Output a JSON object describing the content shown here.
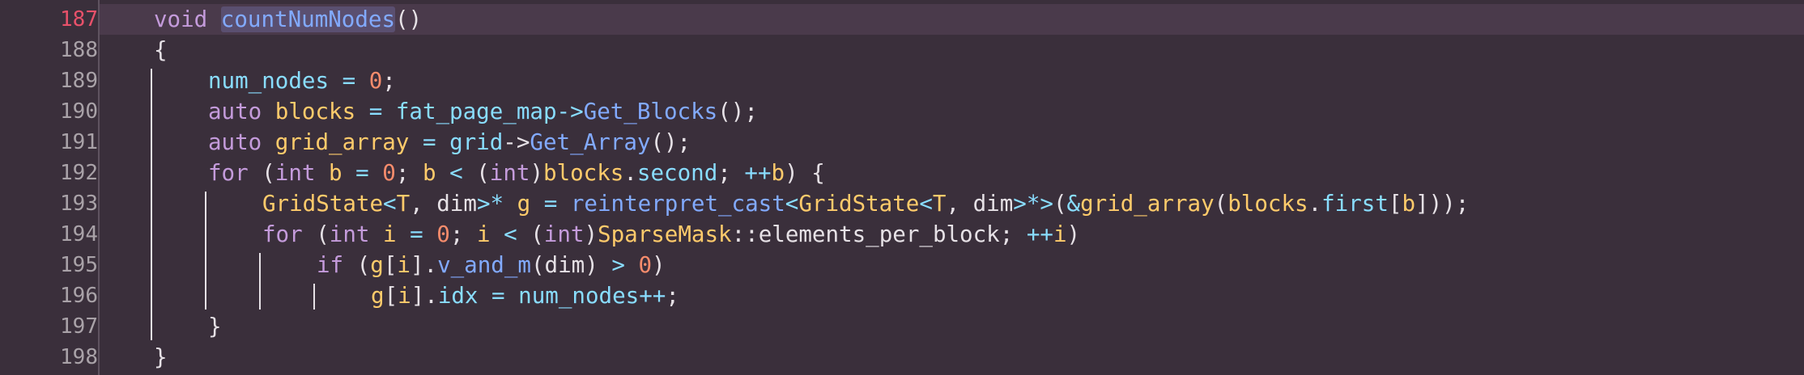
{
  "editor": {
    "language": "cpp",
    "current_line": "187",
    "colors": {
      "background": "#3a2f3b",
      "current_line_bg": "#4a3a4b",
      "active_line_number": "#e8516a",
      "line_number": "#a9a2a8",
      "keyword": "#c49bdb",
      "function": "#82aaff",
      "variable": "#89ddff",
      "type": "#ffcb6b",
      "number": "#f78c6c",
      "text": "#e6e1e6"
    },
    "line_numbers": [
      "187",
      "188",
      "189",
      "190",
      "191",
      "192",
      "193",
      "194",
      "195",
      "196",
      "197",
      "198"
    ],
    "lines": [
      [
        [
          "kw",
          "void"
        ],
        [
          "pl",
          " "
        ],
        [
          "fn hl",
          "countNumNodes"
        ],
        [
          "pl",
          "()"
        ]
      ],
      [
        [
          "pl",
          "{"
        ]
      ],
      [
        [
          "vr",
          "num_nodes"
        ],
        [
          "pl",
          " "
        ],
        [
          "op",
          "="
        ],
        [
          "pl",
          " "
        ],
        [
          "num",
          "0"
        ],
        [
          "pl",
          ";"
        ]
      ],
      [
        [
          "kw",
          "auto"
        ],
        [
          "pl",
          " "
        ],
        [
          "vy",
          "blocks"
        ],
        [
          "pl",
          " "
        ],
        [
          "op",
          "="
        ],
        [
          "pl",
          " "
        ],
        [
          "vr",
          "fat_page_map"
        ],
        [
          "op",
          "->"
        ],
        [
          "fn",
          "Get_Blocks"
        ],
        [
          "pl",
          "();"
        ]
      ],
      [
        [
          "kw",
          "auto"
        ],
        [
          "pl",
          " "
        ],
        [
          "vy",
          "grid_array"
        ],
        [
          "pl",
          " "
        ],
        [
          "op",
          "="
        ],
        [
          "pl",
          " "
        ],
        [
          "vr",
          "grid"
        ],
        [
          "pl",
          "->"
        ],
        [
          "fn",
          "Get_Array"
        ],
        [
          "pl",
          "();"
        ]
      ],
      [
        [
          "kw",
          "for"
        ],
        [
          "pl",
          " ("
        ],
        [
          "kw",
          "int"
        ],
        [
          "pl",
          " "
        ],
        [
          "vy",
          "b"
        ],
        [
          "pl",
          " "
        ],
        [
          "op",
          "="
        ],
        [
          "pl",
          " "
        ],
        [
          "num",
          "0"
        ],
        [
          "pl",
          "; "
        ],
        [
          "vy",
          "b"
        ],
        [
          "pl",
          " "
        ],
        [
          "op",
          "<"
        ],
        [
          "pl",
          " ("
        ],
        [
          "kw",
          "int"
        ],
        [
          "pl",
          ")"
        ],
        [
          "vy",
          "blocks"
        ],
        [
          "pl",
          "."
        ],
        [
          "vr",
          "second"
        ],
        [
          "pl",
          "; "
        ],
        [
          "op",
          "++"
        ],
        [
          "vy",
          "b"
        ],
        [
          "pl",
          ") {"
        ]
      ],
      [
        [
          "vy",
          "GridState"
        ],
        [
          "op",
          "<"
        ],
        [
          "vy",
          "T"
        ],
        [
          "pl",
          ", dim"
        ],
        [
          "op",
          ">*"
        ],
        [
          "pl",
          " "
        ],
        [
          "vy",
          "g"
        ],
        [
          "pl",
          " "
        ],
        [
          "op",
          "="
        ],
        [
          "pl",
          " "
        ],
        [
          "fn",
          "reinterpret_cast"
        ],
        [
          "op",
          "<"
        ],
        [
          "vy",
          "GridState"
        ],
        [
          "op",
          "<"
        ],
        [
          "vy",
          "T"
        ],
        [
          "pl",
          ", dim"
        ],
        [
          "op",
          ">*>"
        ],
        [
          "pl",
          "("
        ],
        [
          "op",
          "&"
        ],
        [
          "vy",
          "grid_array"
        ],
        [
          "pl",
          "("
        ],
        [
          "vy",
          "blocks"
        ],
        [
          "pl",
          "."
        ],
        [
          "vr",
          "first"
        ],
        [
          "pl",
          "["
        ],
        [
          "vy",
          "b"
        ],
        [
          "pl",
          "]));"
        ]
      ],
      [
        [
          "kw",
          "for"
        ],
        [
          "pl",
          " ("
        ],
        [
          "kw",
          "int"
        ],
        [
          "pl",
          " "
        ],
        [
          "vy",
          "i"
        ],
        [
          "pl",
          " "
        ],
        [
          "op",
          "="
        ],
        [
          "pl",
          " "
        ],
        [
          "num",
          "0"
        ],
        [
          "pl",
          "; "
        ],
        [
          "vy",
          "i"
        ],
        [
          "pl",
          " "
        ],
        [
          "op",
          "<"
        ],
        [
          "pl",
          " ("
        ],
        [
          "kw",
          "int"
        ],
        [
          "pl",
          ")"
        ],
        [
          "vy",
          "SparseMask"
        ],
        [
          "pl",
          "::elements_per_block; "
        ],
        [
          "op",
          "++"
        ],
        [
          "vy",
          "i"
        ],
        [
          "pl",
          ")"
        ]
      ],
      [
        [
          "kw",
          "if"
        ],
        [
          "pl",
          " ("
        ],
        [
          "vy",
          "g"
        ],
        [
          "pl",
          "["
        ],
        [
          "vy",
          "i"
        ],
        [
          "pl",
          "]."
        ],
        [
          "fn",
          "v_and_m"
        ],
        [
          "pl",
          "(dim) "
        ],
        [
          "op",
          ">"
        ],
        [
          "pl",
          " "
        ],
        [
          "num",
          "0"
        ],
        [
          "pl",
          ")"
        ]
      ],
      [
        [
          "vy",
          "g"
        ],
        [
          "pl",
          "["
        ],
        [
          "vy",
          "i"
        ],
        [
          "pl",
          "]."
        ],
        [
          "vr",
          "idx"
        ],
        [
          "pl",
          " "
        ],
        [
          "op",
          "="
        ],
        [
          "pl",
          " "
        ],
        [
          "vr",
          "num_nodes"
        ],
        [
          "op",
          "++"
        ],
        [
          "pl",
          ";"
        ]
      ],
      [
        [
          "pl",
          "}"
        ]
      ],
      [
        [
          "pl",
          "}"
        ]
      ]
    ]
  }
}
